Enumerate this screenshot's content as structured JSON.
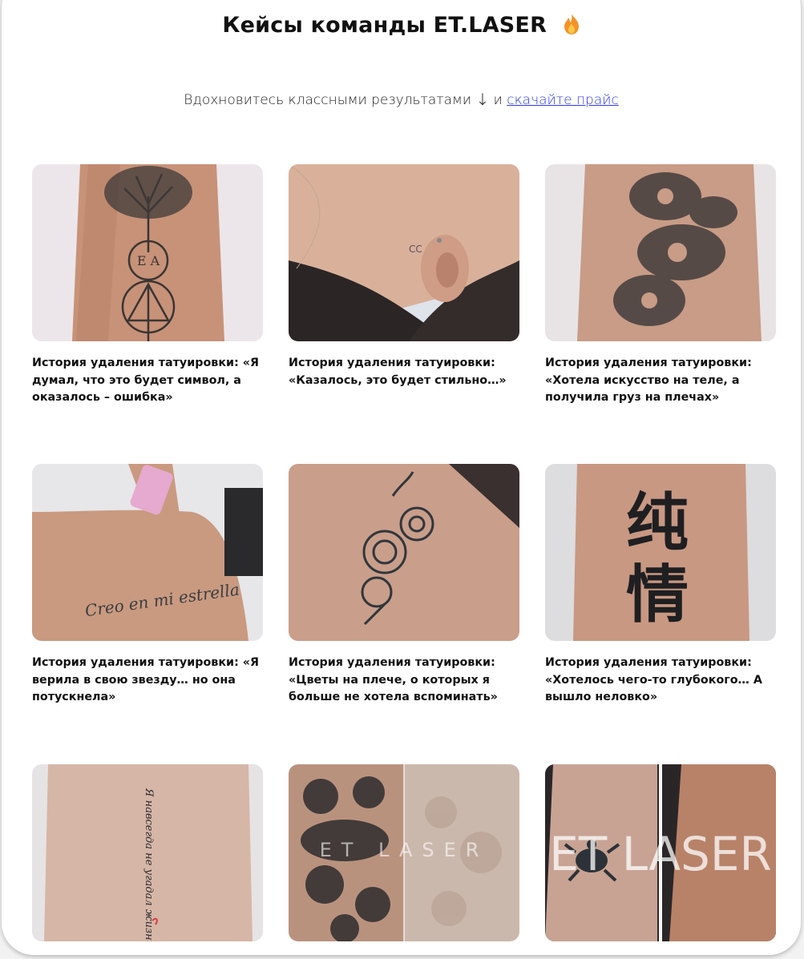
{
  "header": {
    "title": "Кейсы команды ET.LASER",
    "title_icon": "flame-icon"
  },
  "intro": {
    "text": "Вдохновитесь классными результатами",
    "arrow": "↓",
    "connector": "и",
    "link": "скачайте прайс"
  },
  "cases": [
    {
      "caption": "История удаления татуировки: «Я думал, что это будет символ, а оказалось – ошибка»",
      "image": "tree-tattoo-forearm"
    },
    {
      "caption": "История удаления татуировки: «Казалось, это будет стильно…»",
      "image": "logo-tattoo-behind-ear"
    },
    {
      "caption": "История удаления татуировки: «Хотела искусство на теле, а получила груз на плечах»",
      "image": "floral-tattoo-side"
    },
    {
      "caption": "История удаления татуировки: «Я верила в свою звезду… но она потускнела»",
      "image": "script-tattoo-back"
    },
    {
      "caption": "История удаления татуировки: «Цветы на плече, о которых я больше не хотела вспоминать»",
      "image": "rose-tattoo-shoulder"
    },
    {
      "caption": "История удаления татуировки: «Хотелось чего-то глубокого… А вышло неловко»",
      "image": "hieroglyph-tattoo-arm"
    },
    {
      "caption": "",
      "image": "vertical-script-tattoo-arm",
      "overlay_text": "Я навсегда не угадал жизнь"
    },
    {
      "caption": "",
      "image": "sleeve-before-after",
      "watermark": "ET LASER"
    },
    {
      "caption": "",
      "image": "turtle-before-after",
      "watermark": "ET LASER"
    }
  ],
  "colors": {
    "link": "#2f3ce8",
    "skin": "#c89a80",
    "ink": "#2d3033"
  }
}
